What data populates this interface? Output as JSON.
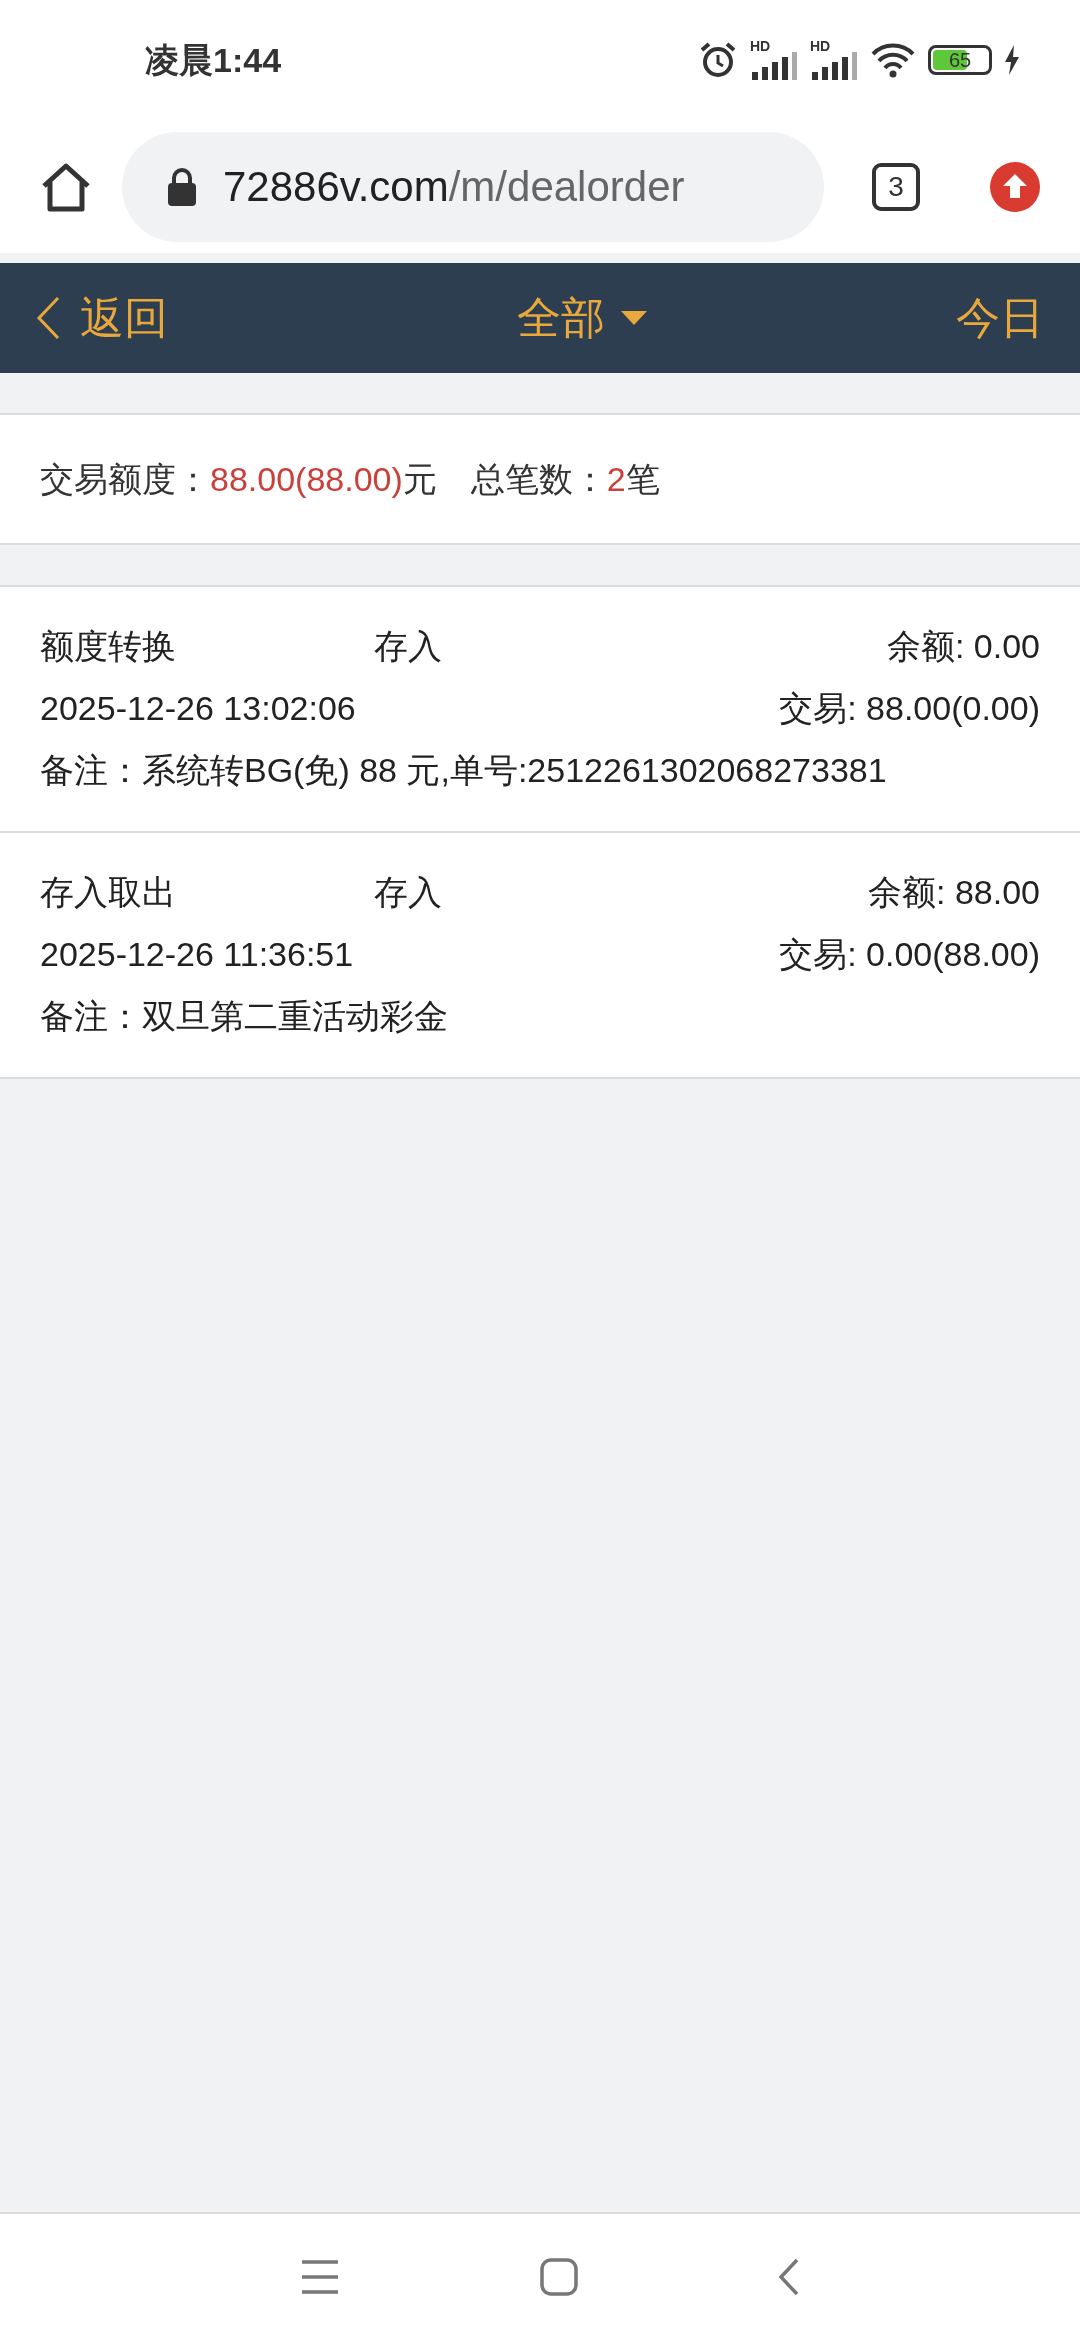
{
  "status_bar": {
    "time": "凌晨1:44",
    "signal_labels": [
      "HD",
      "HD"
    ],
    "battery": "65"
  },
  "browser": {
    "url_host": "72886v.com",
    "url_path": "/m/dealorder",
    "tab_count": "3"
  },
  "header": {
    "back": "返回",
    "filter": "全部",
    "today": "今日"
  },
  "summary": {
    "amount_label": "交易额度：",
    "amount": "88.00(88.00)",
    "amount_unit": "元",
    "count_label": "总笔数：",
    "count": "2",
    "count_unit": "笔"
  },
  "records": [
    {
      "type": "额度转换",
      "direction": "存入",
      "balance": "余额: 0.00",
      "time": "2025-12-26 13:02:06",
      "trade": "交易: 88.00(0.00)",
      "note": "备注：系统转BG(免) 88 元,单号:2512261302068273381"
    },
    {
      "type": "存入取出",
      "direction": "存入",
      "balance": "余额: 88.00",
      "time": "2025-12-26 11:36:51",
      "trade": "交易: 0.00(88.00)",
      "note": "备注：双旦第二重活动彩金"
    }
  ]
}
